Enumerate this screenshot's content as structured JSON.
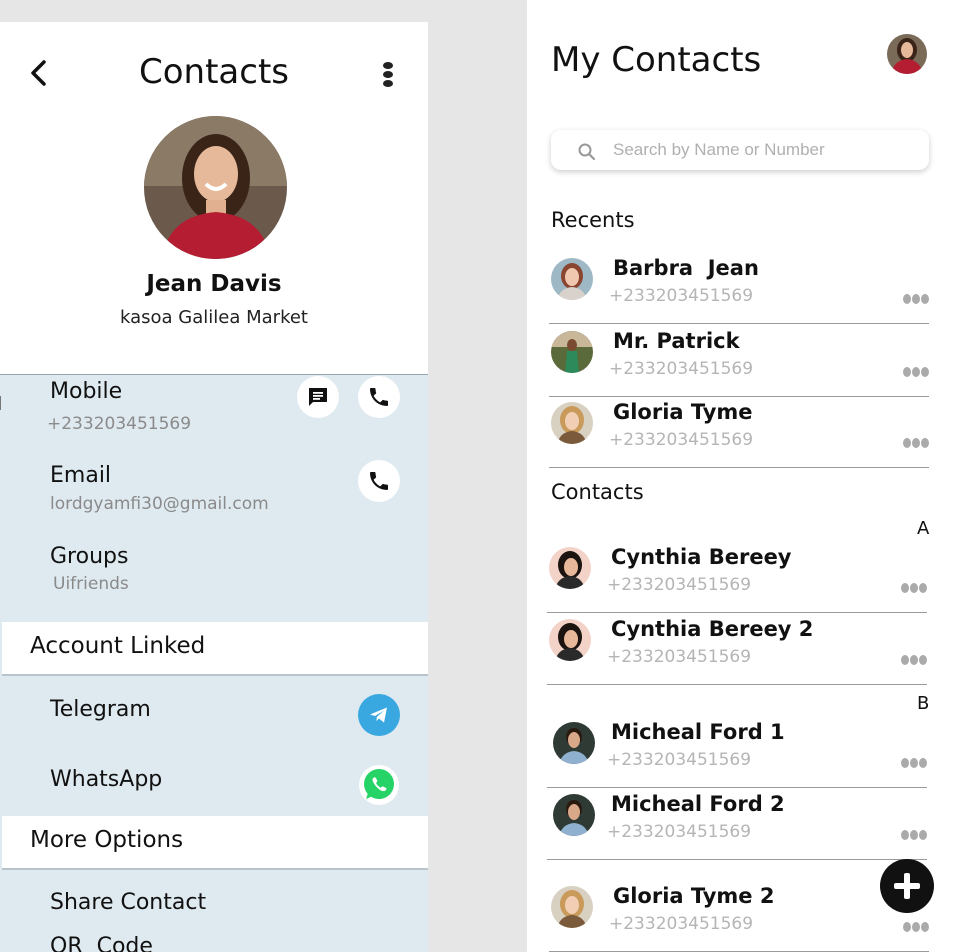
{
  "left": {
    "title": "Contacts",
    "profile": {
      "name": "Jean Davis",
      "address": "kasoa Galilea Market"
    },
    "fields": {
      "mobile_label": "Mobile",
      "mobile_value": "+233203451569",
      "email_label": "Email",
      "email_value": "lordgyamfi30@gmail.com",
      "groups_label": "Groups",
      "groups_value": "Uifriends"
    },
    "account_linked": {
      "title": "Account Linked",
      "telegram": "Telegram",
      "whatsapp": "WhatsApp"
    },
    "more_options": {
      "title": "More Options",
      "share": "Share Contact",
      "qr": "QR  Code"
    }
  },
  "right": {
    "title": "My Contacts",
    "search_placeholder": "Search by Name or Number",
    "recents_label": "Recents",
    "contacts_label": "Contacts",
    "recents": [
      {
        "name": "Barbra  Jean",
        "phone": "+233203451569"
      },
      {
        "name": "Mr. Patrick",
        "phone": "+233203451569"
      },
      {
        "name": "Gloria Tyme",
        "phone": "+233203451569"
      }
    ],
    "letters": {
      "a": "A",
      "b": "B"
    },
    "contacts": [
      {
        "name": "Cynthia Bereey",
        "phone": "+233203451569"
      },
      {
        "name": "Cynthia Bereey 2",
        "phone": "+233203451569"
      },
      {
        "name": "Micheal Ford 1",
        "phone": "+233203451569"
      },
      {
        "name": "Micheal Ford 2",
        "phone": "+233203451569"
      },
      {
        "name": "Gloria Tyme 2",
        "phone": "+233203451569"
      }
    ]
  },
  "colors": {
    "panel_bg": "#dfeaf0",
    "telegram": "#3aa8e0",
    "whatsapp": "#25d366",
    "fab": "#111111"
  },
  "icons": [
    "back-chevron-icon",
    "more-vertical-icon",
    "message-icon",
    "phone-icon",
    "telegram-icon",
    "whatsapp-icon",
    "search-icon",
    "more-horizontal-icon",
    "add-icon"
  ]
}
